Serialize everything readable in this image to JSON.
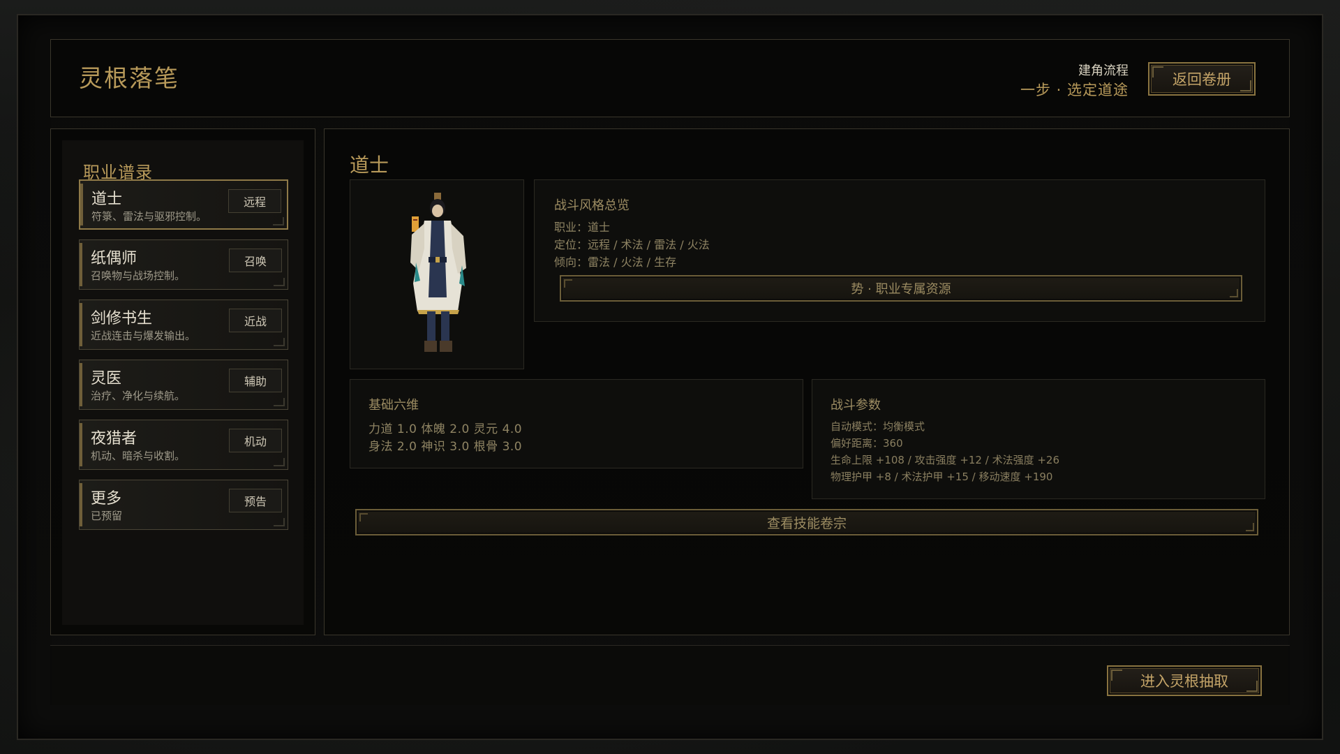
{
  "header": {
    "title": "灵根落笔",
    "flow_label": "建角流程",
    "flow_step": "一步 · 选定道途",
    "return_button": "返回卷册"
  },
  "sidebar": {
    "title": "职业谱录",
    "classes": [
      {
        "name": "道士",
        "desc": "符箓、雷法与驱邪控制。",
        "tag": "远程"
      },
      {
        "name": "纸偶师",
        "desc": "召唤物与战场控制。",
        "tag": "召唤"
      },
      {
        "name": "剑修书生",
        "desc": "近战连击与爆发输出。",
        "tag": "近战"
      },
      {
        "name": "灵医",
        "desc": "治疗、净化与续航。",
        "tag": "辅助"
      },
      {
        "name": "夜猎者",
        "desc": "机动、暗杀与收割。",
        "tag": "机动"
      },
      {
        "name": "更多",
        "desc": "已预留",
        "tag": "预告"
      }
    ]
  },
  "main": {
    "title": "道士",
    "overview": {
      "heading": "战斗风格总览",
      "profession": "职业：道士",
      "role": "定位：远程 / 术法 / 雷法 / 火法",
      "tendency": "倾向：雷法 / 火法 / 生存",
      "resource_bar": "势 · 职业专属资源"
    },
    "stats": {
      "heading": "基础六维",
      "line1": "力道 1.0  体魄 2.0  灵元 4.0",
      "line2": "身法 2.0  神识 3.0  根骨 3.0"
    },
    "params": {
      "heading": "战斗参数",
      "auto_mode": "自动模式：均衡模式",
      "pref_range": "偏好距离：360",
      "line3": "生命上限 +108 / 攻击强度 +12 / 术法强度 +26",
      "line4": "物理护甲 +8 / 术法护甲 +15 / 移动速度 +190"
    },
    "skills_button": "查看技能卷宗"
  },
  "footer": {
    "enter_button": "进入灵根抽取"
  },
  "colors": {
    "accent_gold": "#b89a5a",
    "border_gold": "#8a7440",
    "text_light": "#e6e0d0"
  }
}
